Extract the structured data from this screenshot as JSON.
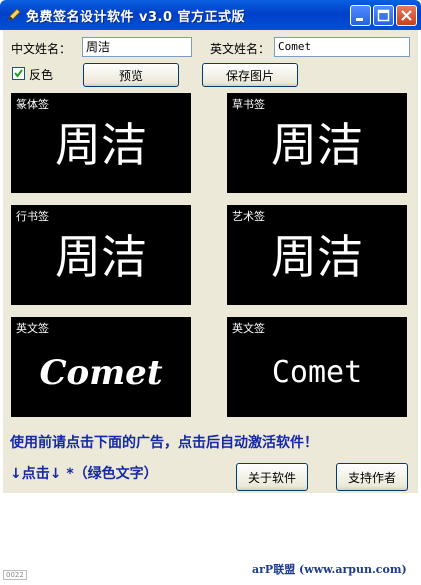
{
  "window": {
    "title": "免费签名设计软件   v3.0  官方正式版"
  },
  "form": {
    "cn_name_label": "中文姓名：",
    "cn_name_value": "周洁",
    "en_name_label": "英文姓名：",
    "en_name_value": "Comet",
    "invert_label": "反色",
    "invert_checked": true,
    "preview_button": "预览",
    "save_button": "保存图片"
  },
  "panels": [
    {
      "label": "篆体签",
      "text": "周洁"
    },
    {
      "label": "草书签",
      "text": "周洁"
    },
    {
      "label": "行书签",
      "text": "周洁"
    },
    {
      "label": "艺术签",
      "text": "周洁"
    },
    {
      "label": "英文签",
      "text": "Comet"
    },
    {
      "label": "英文签",
      "text": "Comet"
    }
  ],
  "ad": {
    "line1": "使用前请点击下面的广告，点击后自动激活软件！",
    "line2": "↓点击↓ *（绿色文字）"
  },
  "footer_buttons": {
    "about": "关于软件",
    "support": "支持作者"
  },
  "watermark": "arP联盟 (www.arpun.com)",
  "corner_badge": "0022",
  "colors": {
    "titlebar": "#0a5fe0",
    "panel_bg": "#000000",
    "ad_text": "#1428a8"
  }
}
